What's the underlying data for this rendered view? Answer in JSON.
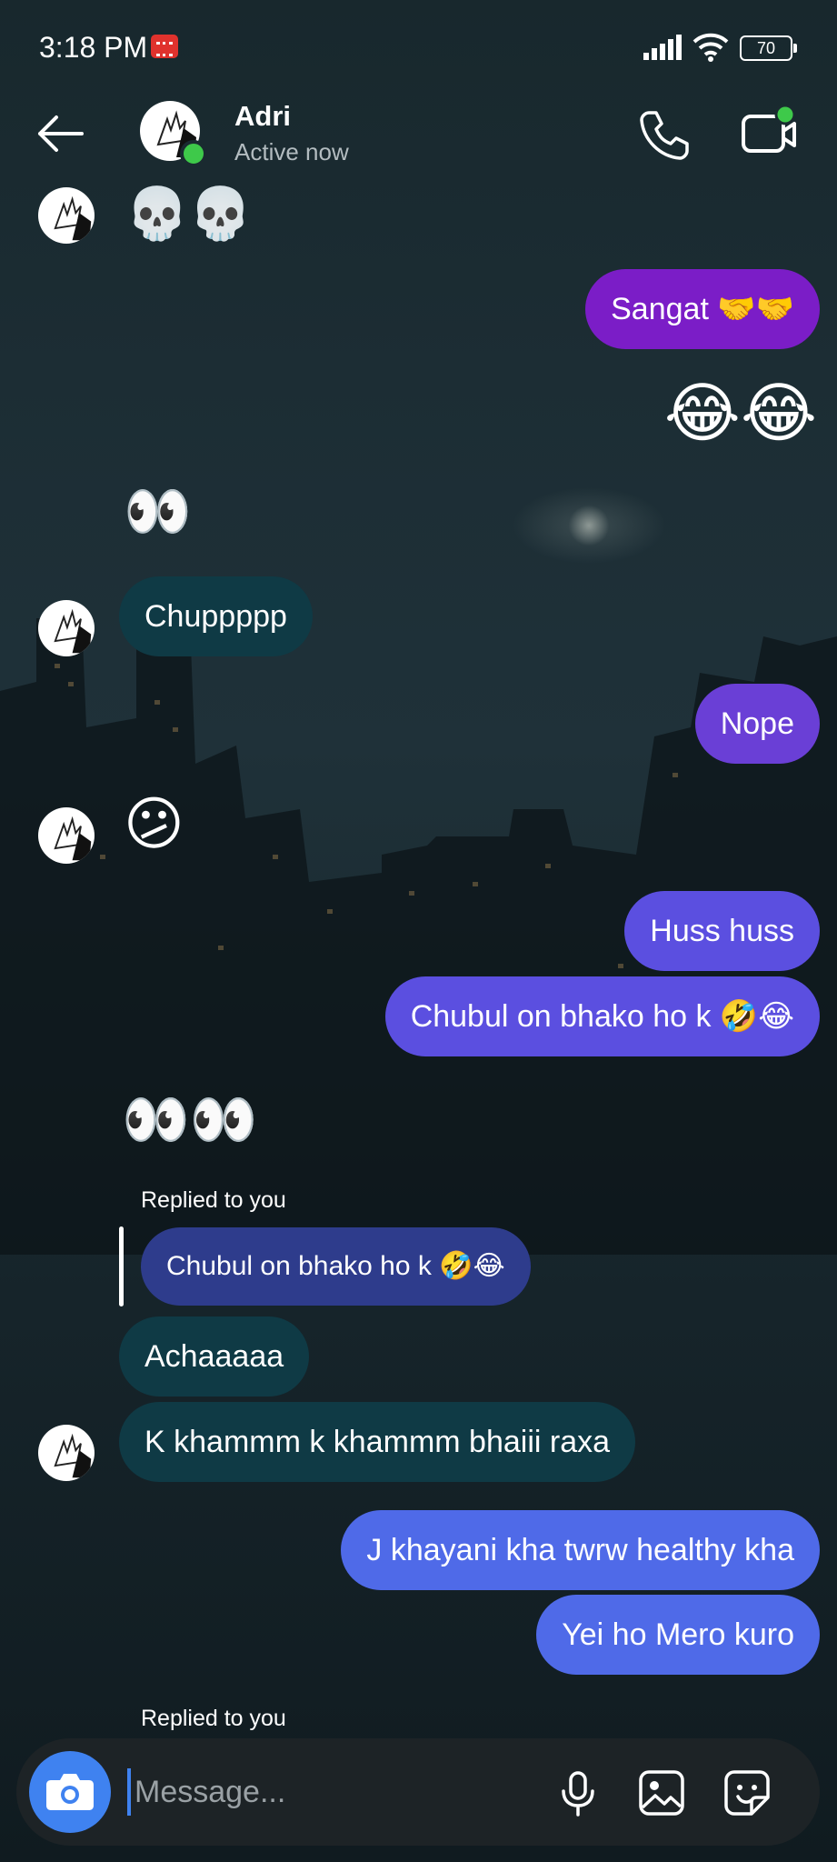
{
  "status_bar": {
    "time": "3:18 PM",
    "battery": "70"
  },
  "header": {
    "contact_name": "Adri",
    "presence": "Active now"
  },
  "messages": {
    "m1_emoji": "💀💀",
    "m2_text": "Sangat 🤝🤝",
    "m3_emoji": "😂😂",
    "m4_emoji": "👀",
    "m5_text": "Chuppppp",
    "m6_text": "Nope",
    "m7_emoji": "😕",
    "m8_text": "Huss huss",
    "m9_text": "Chubul on bhako ho k 🤣😂",
    "m10_emoji": "👀👀",
    "m11_reply_label": "Replied to you",
    "m11_quoted": "Chubul on bhako ho k 🤣😂",
    "m12_text": "Achaaaaa",
    "m13_text": "K khammm k khammm bhaiii raxa",
    "m14_text": "J khayani kha twrw healthy kha",
    "m15_text": "Yei ho Mero kuro",
    "m16_reply_label": "Replied to you"
  },
  "composer": {
    "placeholder": "Message..."
  },
  "icons": {
    "back": "arrow-left-icon",
    "call": "phone-icon",
    "video": "video-camera-icon",
    "camera": "camera-icon",
    "mic": "microphone-icon",
    "gallery": "image-icon",
    "sticker": "sticker-icon"
  },
  "colors": {
    "accent_blue": "#3f82f0",
    "incoming_bubble": "#0f3a45",
    "outgoing_purple": "#7b1dc7",
    "outgoing_blue": "#4f6ae8",
    "online": "#3ec94a"
  }
}
